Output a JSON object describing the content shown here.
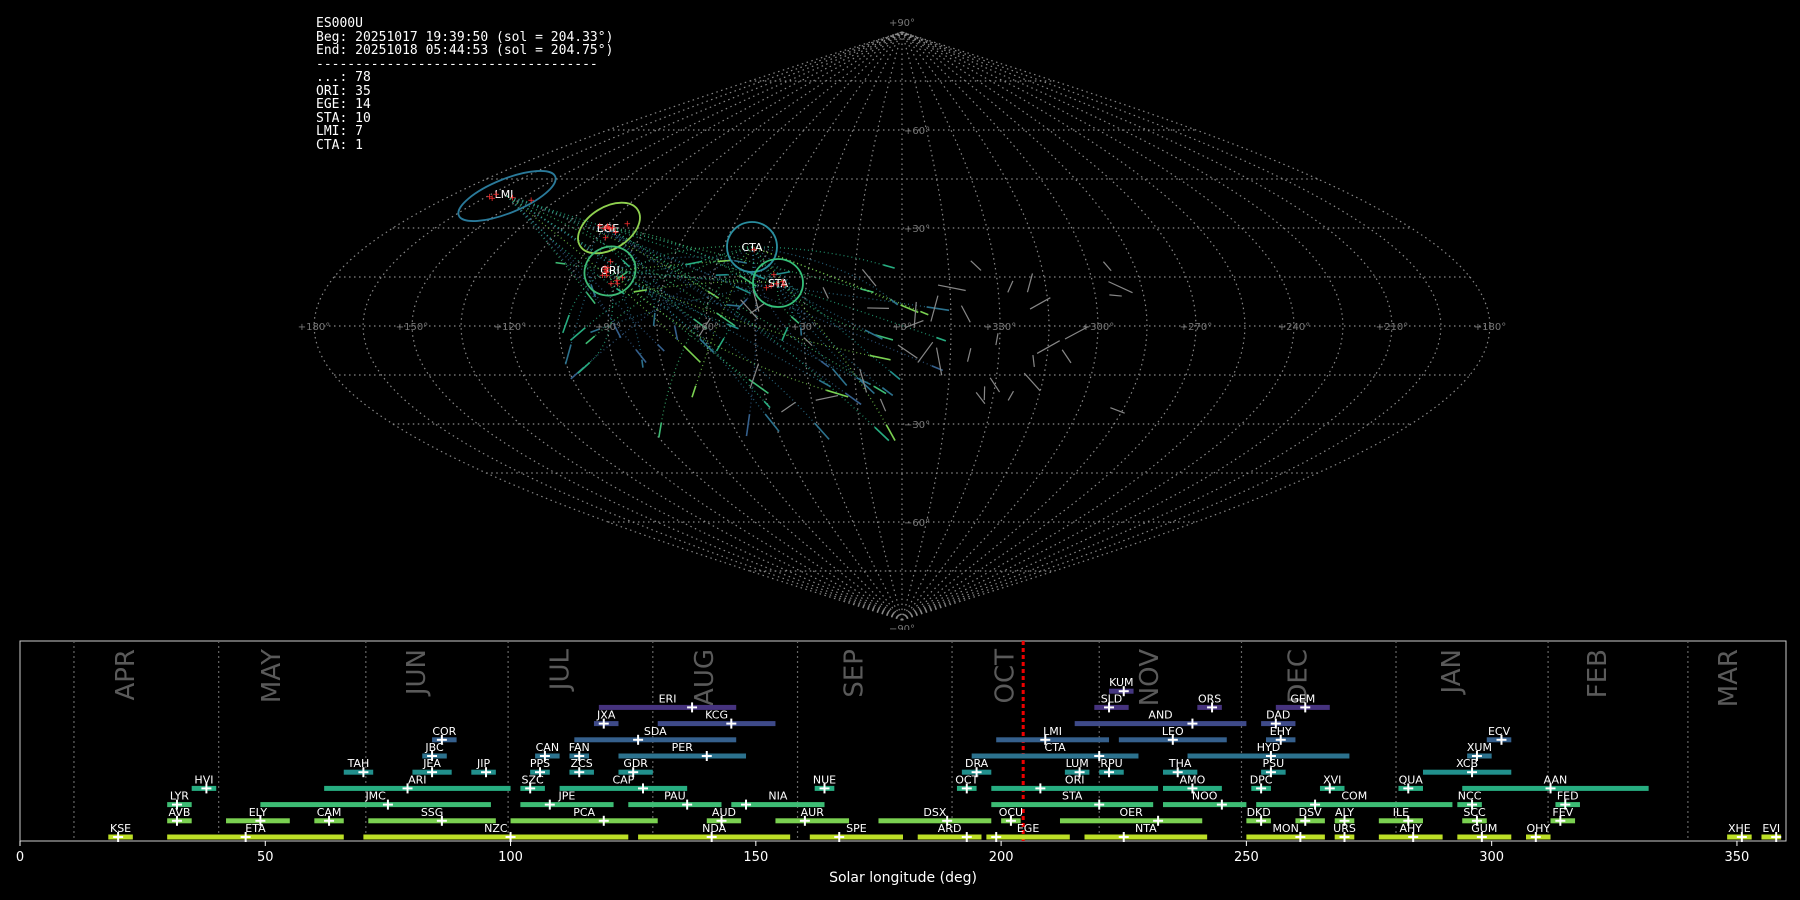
{
  "info": {
    "station": "ES000U",
    "beg": "Beg: 20251017 19:39:50 (sol = 204.33°)",
    "end": "End: 20251018 05:44:53 (sol = 204.75°)",
    "separator": "------------------------------------",
    "counts": [
      "...: 78",
      "ORI: 35",
      "EGE: 14",
      "STA: 10",
      "LMI: 7",
      "CTA: 1"
    ]
  },
  "sky_labels": {
    "top": "+90°",
    "bottom": "−90°",
    "lat_labels": [
      "+60°",
      "+30°",
      "−30°",
      "−60°"
    ],
    "lon_labels": [
      "+180°",
      "+150°",
      "+120°",
      "+90°",
      "+60°",
      "+30°",
      "+0°",
      "+330°",
      "+300°",
      "+270°",
      "+240°",
      "+210°",
      "+180°"
    ],
    "showers": [
      {
        "code": "LMI",
        "color": "#2a7a9a"
      },
      {
        "code": "EGE",
        "color": "#8fd14f"
      },
      {
        "code": "ORI",
        "color": "#3dbb77"
      },
      {
        "code": "CTA",
        "color": "#2a8fa0"
      },
      {
        "code": "STA",
        "color": "#35c07a"
      }
    ]
  },
  "chart_data": {
    "type": "bar",
    "xlabel": "Solar longitude (deg)",
    "xlim": [
      0,
      360
    ],
    "xticks": [
      0,
      50,
      100,
      150,
      200,
      250,
      300,
      350
    ],
    "current_sol": 204.5,
    "months": [
      "APR",
      "MAY",
      "JUN",
      "JUL",
      "AUG",
      "SEP",
      "OCT",
      "NOV",
      "DEC",
      "JAN",
      "FEB",
      "MAR"
    ],
    "bars": [
      {
        "code": "KUM",
        "start": 222,
        "end": 227,
        "peak": 225,
        "row": 10,
        "color": "#453781"
      },
      {
        "code": "ERI",
        "start": 118,
        "end": 146,
        "peak": 137,
        "row": 9,
        "color": "#46337e"
      },
      {
        "code": "SLD",
        "start": 219,
        "end": 226,
        "peak": 222,
        "row": 9,
        "color": "#46337e"
      },
      {
        "code": "ORS",
        "start": 240,
        "end": 245,
        "peak": 243,
        "row": 9,
        "color": "#46337e"
      },
      {
        "code": "GEM",
        "start": 256,
        "end": 267,
        "peak": 262,
        "row": 9,
        "color": "#46337e"
      },
      {
        "code": "JXA",
        "start": 117,
        "end": 122,
        "peak": 119,
        "row": 8,
        "color": "#3e4a89"
      },
      {
        "code": "KCG",
        "start": 130,
        "end": 154,
        "peak": 145,
        "row": 8,
        "color": "#3e4a89"
      },
      {
        "code": "AND",
        "start": 215,
        "end": 250,
        "peak": 239,
        "row": 8,
        "color": "#3e4a89"
      },
      {
        "code": "DAD",
        "start": 253,
        "end": 260,
        "peak": 256,
        "row": 8,
        "color": "#3e4a89"
      },
      {
        "code": "COR",
        "start": 84,
        "end": 89,
        "peak": 86,
        "row": 7,
        "color": "#35608d"
      },
      {
        "code": "SDA",
        "start": 113,
        "end": 146,
        "peak": 126,
        "row": 7,
        "color": "#35608d"
      },
      {
        "code": "LMI",
        "start": 199,
        "end": 222,
        "peak": 209,
        "row": 7,
        "color": "#35608d"
      },
      {
        "code": "LEO",
        "start": 224,
        "end": 246,
        "peak": 235,
        "row": 7,
        "color": "#35608d"
      },
      {
        "code": "EHY",
        "start": 254,
        "end": 260,
        "peak": 257,
        "row": 7,
        "color": "#35608d"
      },
      {
        "code": "ECV",
        "start": 299,
        "end": 304,
        "peak": 302,
        "row": 7,
        "color": "#35608d"
      },
      {
        "code": "JBC",
        "start": 82,
        "end": 87,
        "peak": 84,
        "row": 6,
        "color": "#2c728e"
      },
      {
        "code": "CAN",
        "start": 105,
        "end": 110,
        "peak": 107,
        "row": 6,
        "color": "#2c728e"
      },
      {
        "code": "FAN",
        "start": 112,
        "end": 116,
        "peak": 114,
        "row": 6,
        "color": "#2c728e"
      },
      {
        "code": "PER",
        "start": 122,
        "end": 148,
        "peak": 140,
        "row": 6,
        "color": "#2c728e"
      },
      {
        "code": "CTA",
        "start": 194,
        "end": 228,
        "peak": 220,
        "row": 6,
        "color": "#2c728e"
      },
      {
        "code": "HYD",
        "start": 238,
        "end": 271,
        "peak": 255,
        "row": 6,
        "color": "#2c728e"
      },
      {
        "code": "XUM",
        "start": 295,
        "end": 300,
        "peak": 297,
        "row": 6,
        "color": "#2c728e"
      },
      {
        "code": "TAH",
        "start": 66,
        "end": 72,
        "peak": 70,
        "row": 5,
        "color": "#21908d"
      },
      {
        "code": "JEA",
        "start": 80,
        "end": 88,
        "peak": 84,
        "row": 5,
        "color": "#21908d"
      },
      {
        "code": "JIP",
        "start": 92,
        "end": 97,
        "peak": 95,
        "row": 5,
        "color": "#21908d"
      },
      {
        "code": "PPS",
        "start": 104,
        "end": 108,
        "peak": 106,
        "row": 5,
        "color": "#21908d"
      },
      {
        "code": "ZCS",
        "start": 112,
        "end": 117,
        "peak": 114,
        "row": 5,
        "color": "#21908d"
      },
      {
        "code": "GDR",
        "start": 122,
        "end": 129,
        "peak": 125,
        "row": 5,
        "color": "#21908d"
      },
      {
        "code": "DRA",
        "start": 192,
        "end": 198,
        "peak": 195,
        "row": 5,
        "color": "#21908d"
      },
      {
        "code": "LUM",
        "start": 213,
        "end": 218,
        "peak": 216,
        "row": 5,
        "color": "#21908d"
      },
      {
        "code": "RPU",
        "start": 220,
        "end": 225,
        "peak": 222,
        "row": 5,
        "color": "#21908d"
      },
      {
        "code": "THA",
        "start": 233,
        "end": 240,
        "peak": 236,
        "row": 5,
        "color": "#21908d"
      },
      {
        "code": "PSU",
        "start": 253,
        "end": 258,
        "peak": 255,
        "row": 5,
        "color": "#21908d"
      },
      {
        "code": "XCB",
        "start": 286,
        "end": 304,
        "peak": 296,
        "row": 5,
        "color": "#21908d"
      },
      {
        "code": "HVI",
        "start": 35,
        "end": 40,
        "peak": 38,
        "row": 4,
        "color": "#27ad81"
      },
      {
        "code": "ARI",
        "start": 62,
        "end": 100,
        "peak": 79,
        "row": 4,
        "color": "#27ad81"
      },
      {
        "code": "SZC",
        "start": 102,
        "end": 107,
        "peak": 104,
        "row": 4,
        "color": "#27ad81"
      },
      {
        "code": "CAP",
        "start": 110,
        "end": 136,
        "peak": 127,
        "row": 4,
        "color": "#27ad81"
      },
      {
        "code": "NUE",
        "start": 162,
        "end": 166,
        "peak": 164,
        "row": 4,
        "color": "#27ad81"
      },
      {
        "code": "OCT",
        "start": 191,
        "end": 195,
        "peak": 193,
        "row": 4,
        "color": "#27ad81"
      },
      {
        "code": "ORI",
        "start": 198,
        "end": 232,
        "peak": 208,
        "row": 4,
        "color": "#27ad81"
      },
      {
        "code": "AMO",
        "start": 233,
        "end": 245,
        "peak": 239,
        "row": 4,
        "color": "#27ad81"
      },
      {
        "code": "DPC",
        "start": 251,
        "end": 255,
        "peak": 253,
        "row": 4,
        "color": "#27ad81"
      },
      {
        "code": "XVI",
        "start": 265,
        "end": 270,
        "peak": 267,
        "row": 4,
        "color": "#27ad81"
      },
      {
        "code": "QUA",
        "start": 281,
        "end": 286,
        "peak": 283,
        "row": 4,
        "color": "#27ad81"
      },
      {
        "code": "AAN",
        "start": 294,
        "end": 332,
        "peak": 312,
        "row": 4,
        "color": "#27ad81"
      },
      {
        "code": "LYR",
        "start": 30,
        "end": 35,
        "peak": 32,
        "row": 3,
        "color": "#3dbc74"
      },
      {
        "code": "JMC",
        "start": 49,
        "end": 96,
        "peak": 75,
        "row": 3,
        "color": "#3dbc74"
      },
      {
        "code": "JPE",
        "start": 102,
        "end": 121,
        "peak": 108,
        "row": 3,
        "color": "#3dbc74"
      },
      {
        "code": "PAU",
        "start": 124,
        "end": 143,
        "peak": 136,
        "row": 3,
        "color": "#3dbc74"
      },
      {
        "code": "NIA",
        "start": 145,
        "end": 164,
        "peak": 148,
        "row": 3,
        "color": "#3dbc74"
      },
      {
        "code": "STA",
        "start": 198,
        "end": 231,
        "peak": 220,
        "row": 3,
        "color": "#3dbc74"
      },
      {
        "code": "NOO",
        "start": 233,
        "end": 250,
        "peak": 245,
        "row": 3,
        "color": "#3dbc74"
      },
      {
        "code": "COM",
        "start": 252,
        "end": 292,
        "peak": 264,
        "row": 3,
        "color": "#3dbc74"
      },
      {
        "code": "NCC",
        "start": 293,
        "end": 298,
        "peak": 296,
        "row": 3,
        "color": "#3dbc74"
      },
      {
        "code": "FED",
        "start": 313,
        "end": 318,
        "peak": 315,
        "row": 3,
        "color": "#3dbc74"
      },
      {
        "code": "AVB",
        "start": 30,
        "end": 35,
        "peak": 32,
        "row": 2,
        "color": "#7ad151"
      },
      {
        "code": "ELY",
        "start": 42,
        "end": 55,
        "peak": 49,
        "row": 2,
        "color": "#7ad151"
      },
      {
        "code": "CAM",
        "start": 60,
        "end": 66,
        "peak": 63,
        "row": 2,
        "color": "#7ad151"
      },
      {
        "code": "SSG",
        "start": 71,
        "end": 97,
        "peak": 86,
        "row": 2,
        "color": "#7ad151"
      },
      {
        "code": "PCA",
        "start": 100,
        "end": 130,
        "peak": 119,
        "row": 2,
        "color": "#7ad151"
      },
      {
        "code": "AUD",
        "start": 140,
        "end": 147,
        "peak": 143,
        "row": 2,
        "color": "#7ad151"
      },
      {
        "code": "AUR",
        "start": 154,
        "end": 169,
        "peak": 160,
        "row": 2,
        "color": "#7ad151"
      },
      {
        "code": "DSX",
        "start": 175,
        "end": 198,
        "peak": 189,
        "row": 2,
        "color": "#7ad151"
      },
      {
        "code": "OCU",
        "start": 200,
        "end": 204,
        "peak": 202,
        "row": 2,
        "color": "#7ad151"
      },
      {
        "code": "OER",
        "start": 212,
        "end": 241,
        "peak": 232,
        "row": 2,
        "color": "#7ad151"
      },
      {
        "code": "DKD",
        "start": 250,
        "end": 255,
        "peak": 253,
        "row": 2,
        "color": "#7ad151"
      },
      {
        "code": "DSV",
        "start": 260,
        "end": 266,
        "peak": 262,
        "row": 2,
        "color": "#7ad151"
      },
      {
        "code": "ALY",
        "start": 268,
        "end": 272,
        "peak": 270,
        "row": 2,
        "color": "#7ad151"
      },
      {
        "code": "ILE",
        "start": 277,
        "end": 286,
        "peak": 283,
        "row": 2,
        "color": "#7ad151"
      },
      {
        "code": "SCC",
        "start": 294,
        "end": 299,
        "peak": 297,
        "row": 2,
        "color": "#7ad151"
      },
      {
        "code": "FEV",
        "start": 312,
        "end": 317,
        "peak": 314,
        "row": 2,
        "color": "#7ad151"
      },
      {
        "code": "KSE",
        "start": 18,
        "end": 23,
        "peak": 20,
        "row": 1,
        "color": "#bddf26"
      },
      {
        "code": "ETA",
        "start": 30,
        "end": 66,
        "peak": 46,
        "row": 1,
        "color": "#bddf26"
      },
      {
        "code": "NZC",
        "start": 70,
        "end": 124,
        "peak": 100,
        "row": 1,
        "color": "#bddf26"
      },
      {
        "code": "NDA",
        "start": 126,
        "end": 157,
        "peak": 141,
        "row": 1,
        "color": "#bddf26"
      },
      {
        "code": "SPE",
        "start": 161,
        "end": 180,
        "peak": 167,
        "row": 1,
        "color": "#bddf26"
      },
      {
        "code": "ARD",
        "start": 183,
        "end": 196,
        "peak": 193,
        "row": 1,
        "color": "#bddf26"
      },
      {
        "code": "EGE",
        "start": 197,
        "end": 214,
        "peak": 199,
        "row": 1,
        "color": "#bddf26"
      },
      {
        "code": "NTA",
        "start": 217,
        "end": 242,
        "peak": 225,
        "row": 1,
        "color": "#bddf26"
      },
      {
        "code": "MON",
        "start": 250,
        "end": 266,
        "peak": 261,
        "row": 1,
        "color": "#bddf26"
      },
      {
        "code": "URS",
        "start": 268,
        "end": 272,
        "peak": 270,
        "row": 1,
        "color": "#bddf26"
      },
      {
        "code": "AHY",
        "start": 277,
        "end": 290,
        "peak": 284,
        "row": 1,
        "color": "#bddf26"
      },
      {
        "code": "GUM",
        "start": 293,
        "end": 304,
        "peak": 298,
        "row": 1,
        "color": "#bddf26"
      },
      {
        "code": "OHY",
        "start": 307,
        "end": 312,
        "peak": 309,
        "row": 1,
        "color": "#bddf26"
      },
      {
        "code": "XHE",
        "start": 348,
        "end": 353,
        "peak": 351,
        "row": 1,
        "color": "#bddf26"
      },
      {
        "code": "EVI",
        "start": 355,
        "end": 359,
        "peak": 358,
        "row": 1,
        "color": "#bddf26"
      }
    ]
  }
}
